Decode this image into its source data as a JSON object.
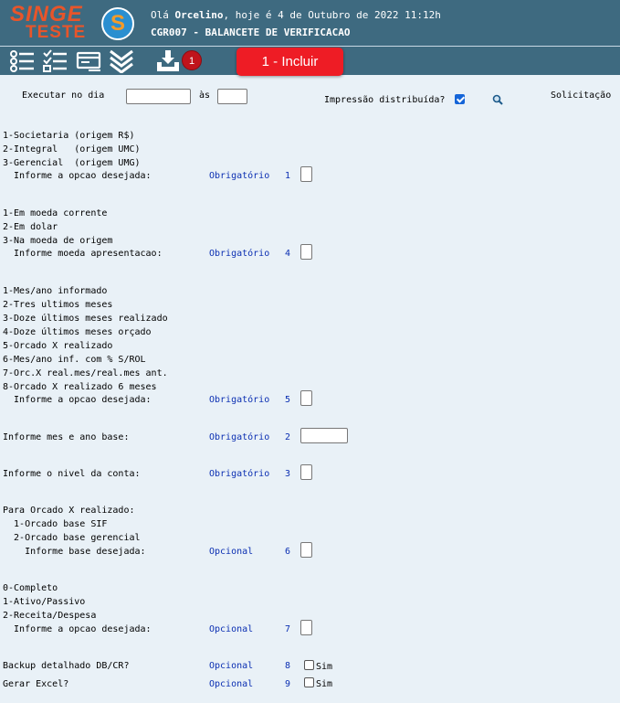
{
  "header": {
    "logo_top": "SINGE",
    "logo_bottom": "TESTE",
    "logo_mark": "S",
    "greeting_prefix": "Olá ",
    "user": "Orcelino",
    "greeting_suffix": ", hoje é 4 de Outubro de 2022 11:12h",
    "program": "CGR007 - BALANCETE DE VERIFICACAO"
  },
  "toolbar": {
    "badge": "1",
    "tooltip": "1 - Incluir",
    "icons": [
      "list-icon",
      "checklist-icon",
      "card-icon",
      "double-chevron-down-icon",
      "download-tray-icon"
    ]
  },
  "schedule": {
    "run_label": "Executar no dia",
    "at_label": "às",
    "distributed_label": "Impressão distribuída?",
    "request_label": "Solicitação"
  },
  "q1": {
    "options": [
      "1-Societaria (origem R$)",
      "2-Integral   (origem UMC)",
      "3-Gerencial  (origem UMG)"
    ],
    "prompt": "  Informe a opcao desejada:",
    "req": "Obrigatório",
    "num": "1"
  },
  "q2": {
    "options": [
      "1-Em moeda corrente",
      "2-Em dolar",
      "3-Na moeda de origem"
    ],
    "prompt": "  Informe moeda apresentacao:",
    "req": "Obrigatório",
    "num": "4"
  },
  "q3": {
    "options": [
      "1-Mes/ano informado",
      "2-Tres ultimos meses",
      "3-Doze últimos meses realizado",
      "4-Doze últimos meses orçado",
      "5-Orcado X realizado",
      "6-Mes/ano inf. com % S/ROL",
      "7-Orc.X real.mes/real.mes ant.",
      "8-Orcado X realizado 6 meses"
    ],
    "prompt": "  Informe a opcao desejada:",
    "req": "Obrigatório",
    "num": "5"
  },
  "q4": {
    "prompt": "Informe mes e ano base:",
    "req": "Obrigatório",
    "num": "2"
  },
  "q5": {
    "prompt": "Informe o nivel da conta:",
    "req": "Obrigatório",
    "num": "3"
  },
  "q6": {
    "title": "Para Orcado X realizado:",
    "options": [
      "  1-Orcado base SIF",
      "  2-Orcado base gerencial"
    ],
    "prompt": "    Informe base desejada:",
    "req": "Opcional",
    "num": "6"
  },
  "q7": {
    "options": [
      "0-Completo",
      "1-Ativo/Passivo",
      "2-Receita/Despesa"
    ],
    "prompt": "  Informe a opcao desejada:",
    "req": "Opcional",
    "num": "7"
  },
  "q8": {
    "prompt": "Backup detalhado DB/CR?",
    "req": "Opcional",
    "num": "8",
    "check_label": "Sim"
  },
  "q9": {
    "prompt": "Gerar Excel?",
    "req": "Opcional",
    "num": "9",
    "check_label": "Sim"
  }
}
